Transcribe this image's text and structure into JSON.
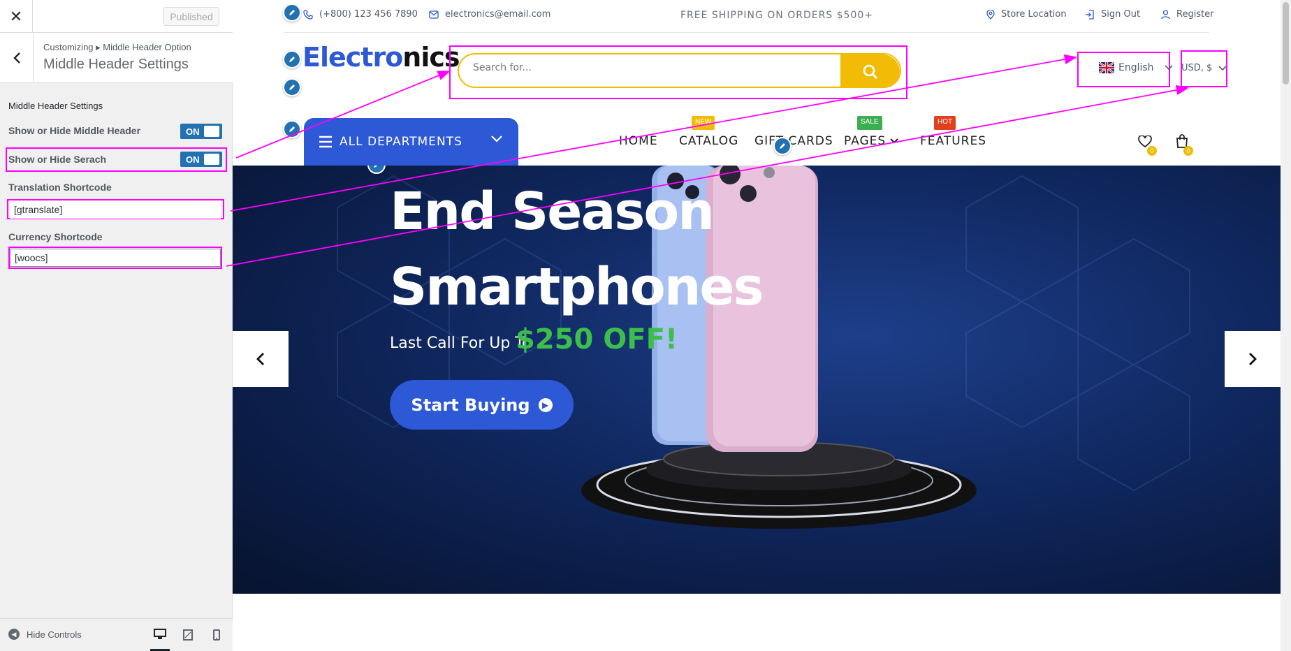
{
  "panel": {
    "close_icon": "close-icon",
    "published_label": "Published",
    "breadcrumb": "Customizing ▸ Middle Header Option",
    "section_title": "Middle Header Settings",
    "controls_heading": "Middle Header Settings",
    "show_middle_label": "Show or Hide Middle Header",
    "show_middle_state": "ON",
    "show_search_label": "Show or Hide Serach",
    "show_search_state": "ON",
    "translation_label": "Translation Shortcode",
    "translation_value": "[gtranslate]",
    "currency_label": "Currency Shortcode",
    "currency_value": "[woocs]",
    "hide_controls": "Hide Controls",
    "highlight_color": "#ff00ff"
  },
  "topbar": {
    "phone": "(+800) 123 456 7890",
    "email": "electronics@email.com",
    "shipping": "FREE SHIPPING ON ORDERS $500+",
    "store_location": "Store Location",
    "sign_out": "Sign Out",
    "register": "Register"
  },
  "header": {
    "logo_part1": "Electro",
    "logo_part2": "nics",
    "search_placeholder": "Search for...",
    "language": "English",
    "currency": "USD, $",
    "brand_color": "#2d58d6",
    "accent_color": "#f2bc06"
  },
  "nav": {
    "departments": "ALL DEPARTMENTS",
    "items": [
      {
        "label": "HOME"
      },
      {
        "label": "CATALOG",
        "badge": "NEW"
      },
      {
        "label": "GIFT CARDS"
      },
      {
        "label": "PAGES",
        "badge": "SALE"
      },
      {
        "label": "FEATURES",
        "badge": "HOT"
      }
    ],
    "wishlist_count": "0",
    "cart_count": "0"
  },
  "hero": {
    "title": "End Season Smartphones",
    "subtitle": "Last Call For Up To",
    "discount": "$250 OFF!",
    "cta": "Start Buying"
  }
}
